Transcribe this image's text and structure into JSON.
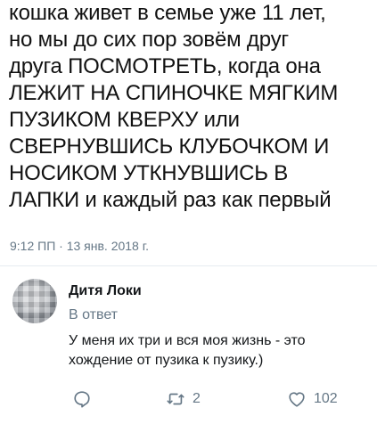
{
  "tweet": {
    "lines": [
      "кошка живет в семье уже 11 лет,",
      "но мы до сих пор зовём друг",
      "друга ПОСМОТРЕТЬ, когда она",
      "ЛЕЖИТ НА СПИНОЧКЕ МЯГКИМ",
      "ПУЗИКОМ КВЕРХУ или",
      "СВЕРНУВШИСЬ КЛУБОЧКОМ И",
      "НОСИКОМ УТКНУВШИСЬ В",
      "ЛАПКИ и каждый раз как первый"
    ],
    "timestamp": "9:12 ПП · 13 янв. 2018 г."
  },
  "reply": {
    "author": "Дитя Локи",
    "in_reply_to": "В ответ",
    "lines": [
      "У меня их три и вся моя жизнь - это",
      "хождение от пузика к пузику.)"
    ]
  },
  "actions": {
    "reply_icon": "reply-bubble-icon",
    "retweet_icon": "retweet-icon",
    "retweet_count": "2",
    "like_icon": "heart-icon",
    "like_count": "102"
  },
  "colors": {
    "text": "#14171a",
    "secondary": "#657786",
    "divider": "#e6ecf0"
  }
}
